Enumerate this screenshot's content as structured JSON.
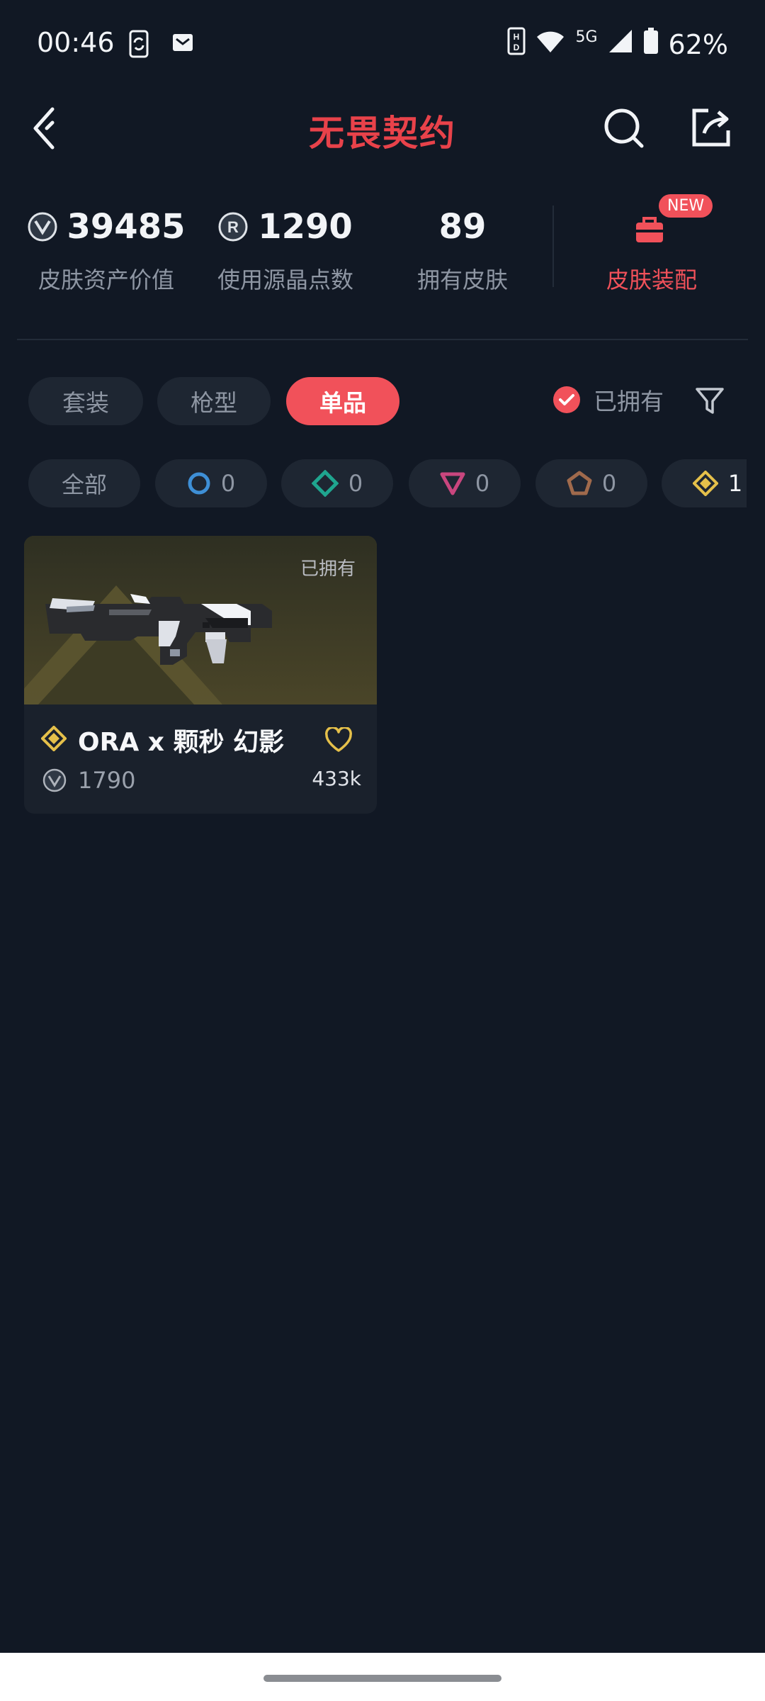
{
  "status_bar": {
    "time": "00:46",
    "network": "5G",
    "battery": "62%"
  },
  "header": {
    "title": "无畏契约"
  },
  "stats": [
    {
      "value": "39485",
      "label": "皮肤资产价值",
      "icon": "vp-coin-icon"
    },
    {
      "value": "1290",
      "label": "使用源晶点数",
      "icon": "radianite-icon"
    },
    {
      "value": "89",
      "label": "拥有皮肤"
    }
  ],
  "loadout": {
    "label": "皮肤装配",
    "badge": "NEW"
  },
  "tabs": [
    {
      "label": "套装",
      "active": false
    },
    {
      "label": "枪型",
      "active": false
    },
    {
      "label": "单品",
      "active": true
    }
  ],
  "owned_toggle": {
    "label": "已拥有",
    "checked": true
  },
  "rarity_filters": [
    {
      "label": "全部"
    },
    {
      "count": "0",
      "icon": "select-tier-icon",
      "color": "#3e8fd6"
    },
    {
      "count": "0",
      "icon": "deluxe-tier-icon",
      "color": "#1fa58f"
    },
    {
      "count": "0",
      "icon": "premium-tier-icon",
      "color": "#c9467e"
    },
    {
      "count": "0",
      "icon": "ultra-tier-icon",
      "color": "#a06a4c"
    },
    {
      "count": "1",
      "icon": "exclusive-tier-icon",
      "color": "#e5c04a"
    }
  ],
  "skins": [
    {
      "owned_label": "已拥有",
      "name": "ORA x 颗秒 幻影",
      "price": "1790",
      "likes": "433k",
      "tier_color": "#e5c04a"
    }
  ],
  "colors": {
    "accent": "#f1515a",
    "background": "#111824"
  }
}
